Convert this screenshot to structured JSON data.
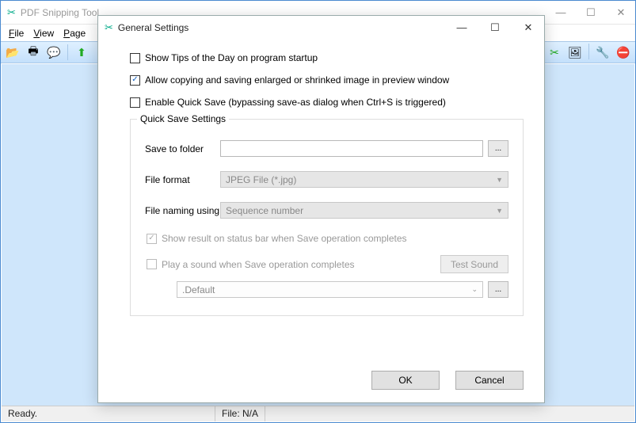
{
  "main": {
    "title": "PDF Snipping Tool",
    "menu": {
      "file": "File",
      "view": "View",
      "page": "Page"
    },
    "status": {
      "ready": "Ready.",
      "file": "File: N/A"
    }
  },
  "dialog": {
    "title": "General Settings",
    "ck_tips": "Show Tips of the Day on program startup",
    "ck_copy": "Allow copying and saving enlarged or shrinked image in preview window",
    "ck_quicksave": "Enable Quick Save (bypassing save-as dialog when Ctrl+S is triggered)",
    "group_legend": "Quick Save Settings",
    "lbl_folder": "Save to folder",
    "lbl_format": "File format",
    "val_format": "JPEG File (*.jpg)",
    "lbl_naming": "File naming using",
    "val_naming": "Sequence number",
    "ck_showresult": "Show result on status bar when Save operation completes",
    "ck_playsound": "Play a sound when Save operation completes",
    "btn_testsound": "Test Sound",
    "val_sound": ".Default",
    "btn_browse": "...",
    "btn_ok": "OK",
    "btn_cancel": "Cancel"
  }
}
